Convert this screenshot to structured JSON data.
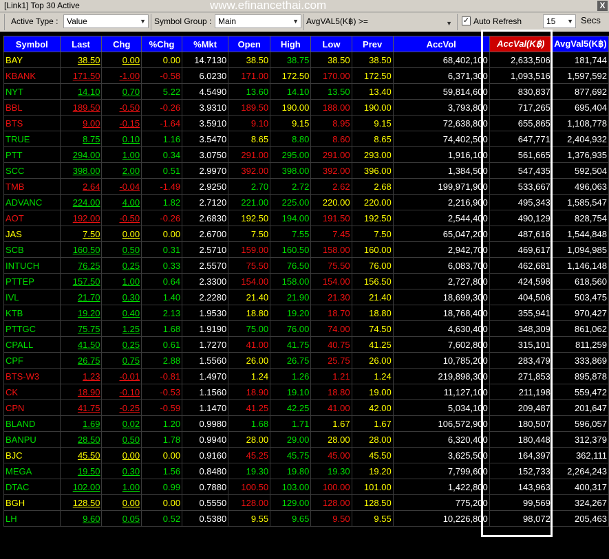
{
  "window": {
    "title": "[Link1] Top 30 Active",
    "watermark": "www.efinancethai.com",
    "close_label": "X"
  },
  "toolbar": {
    "active_type_label": "Active Type :",
    "active_type_value": "Value",
    "symbol_group_label": "Symbol Group :",
    "symbol_group_value": "Main",
    "avgval_label": "AvgVAL5(K฿) >=",
    "auto_refresh_label": "Auto Refresh",
    "auto_refresh_checked": "✓",
    "interval_value": "15",
    "secs_label": "Secs"
  },
  "columns": [
    "Symbol",
    "Last",
    "Chg",
    "%Chg",
    "%Mkt",
    "Open",
    "High",
    "Low",
    "Prev",
    "AccVol",
    "AccVal(K฿)",
    "AvgVal5(K฿)"
  ],
  "sorted_column": "AccVal(K฿)",
  "colors": {
    "up": "#00dd00",
    "down": "#ee1111",
    "unchanged": "#ffff00",
    "header_bg": "#0000ff",
    "sorted_header_bg": "#cc0000"
  },
  "rows": [
    {
      "symbol": "BAY",
      "last": "38.50",
      "chg": "0.00",
      "pct_chg": "0.00",
      "pct_mkt": "14.7130",
      "open": "38.50",
      "high": "38.75",
      "low": "38.50",
      "prev": "38.50",
      "acc_vol": "68,402,100",
      "acc_val": "2,633,506",
      "avg_val5": "181,744",
      "dir": "eq",
      "o": "eq",
      "h": "up",
      "l": "eq"
    },
    {
      "symbol": "KBANK",
      "last": "171.50",
      "chg": "-1.00",
      "pct_chg": "-0.58",
      "pct_mkt": "6.0230",
      "open": "171.00",
      "high": "172.50",
      "low": "170.00",
      "prev": "172.50",
      "acc_vol": "6,371,300",
      "acc_val": "1,093,516",
      "avg_val5": "1,597,592",
      "dir": "dn",
      "o": "dn",
      "h": "eq",
      "l": "dn"
    },
    {
      "symbol": "NYT",
      "last": "14.10",
      "chg": "0.70",
      "pct_chg": "5.22",
      "pct_mkt": "4.5490",
      "open": "13.60",
      "high": "14.10",
      "low": "13.50",
      "prev": "13.40",
      "acc_vol": "59,814,600",
      "acc_val": "830,837",
      "avg_val5": "877,692",
      "dir": "up",
      "o": "up",
      "h": "up",
      "l": "up"
    },
    {
      "symbol": "BBL",
      "last": "189.50",
      "chg": "-0.50",
      "pct_chg": "-0.26",
      "pct_mkt": "3.9310",
      "open": "189.50",
      "high": "190.00",
      "low": "188.00",
      "prev": "190.00",
      "acc_vol": "3,793,800",
      "acc_val": "717,265",
      "avg_val5": "695,404",
      "dir": "dn",
      "o": "dn",
      "h": "eq",
      "l": "dn"
    },
    {
      "symbol": "BTS",
      "last": "9.00",
      "chg": "-0.15",
      "pct_chg": "-1.64",
      "pct_mkt": "3.5910",
      "open": "9.10",
      "high": "9.15",
      "low": "8.95",
      "prev": "9.15",
      "acc_vol": "72,638,800",
      "acc_val": "655,865",
      "avg_val5": "1,108,778",
      "dir": "dn",
      "o": "dn",
      "h": "eq",
      "l": "dn"
    },
    {
      "symbol": "TRUE",
      "last": "8.75",
      "chg": "0.10",
      "pct_chg": "1.16",
      "pct_mkt": "3.5470",
      "open": "8.65",
      "high": "8.80",
      "low": "8.60",
      "prev": "8.65",
      "acc_vol": "74,402,500",
      "acc_val": "647,771",
      "avg_val5": "2,404,932",
      "dir": "up",
      "o": "eq",
      "h": "up",
      "l": "dn"
    },
    {
      "symbol": "PTT",
      "last": "294.00",
      "chg": "1.00",
      "pct_chg": "0.34",
      "pct_mkt": "3.0750",
      "open": "291.00",
      "high": "295.00",
      "low": "291.00",
      "prev": "293.00",
      "acc_vol": "1,916,100",
      "acc_val": "561,665",
      "avg_val5": "1,376,935",
      "dir": "up",
      "o": "dn",
      "h": "up",
      "l": "dn"
    },
    {
      "symbol": "SCC",
      "last": "398.00",
      "chg": "2.00",
      "pct_chg": "0.51",
      "pct_mkt": "2.9970",
      "open": "392.00",
      "high": "398.00",
      "low": "392.00",
      "prev": "396.00",
      "acc_vol": "1,384,500",
      "acc_val": "547,435",
      "avg_val5": "592,504",
      "dir": "up",
      "o": "dn",
      "h": "up",
      "l": "dn"
    },
    {
      "symbol": "TMB",
      "last": "2.64",
      "chg": "-0.04",
      "pct_chg": "-1.49",
      "pct_mkt": "2.9250",
      "open": "2.70",
      "high": "2.72",
      "low": "2.62",
      "prev": "2.68",
      "acc_vol": "199,971,900",
      "acc_val": "533,667",
      "avg_val5": "496,063",
      "dir": "dn",
      "o": "up",
      "h": "up",
      "l": "dn"
    },
    {
      "symbol": "ADVANC",
      "last": "224.00",
      "chg": "4.00",
      "pct_chg": "1.82",
      "pct_mkt": "2.7120",
      "open": "221.00",
      "high": "225.00",
      "low": "220.00",
      "prev": "220.00",
      "acc_vol": "2,216,900",
      "acc_val": "495,343",
      "avg_val5": "1,585,547",
      "dir": "up",
      "o": "up",
      "h": "up",
      "l": "eq"
    },
    {
      "symbol": "AOT",
      "last": "192.00",
      "chg": "-0.50",
      "pct_chg": "-0.26",
      "pct_mkt": "2.6830",
      "open": "192.50",
      "high": "194.00",
      "low": "191.50",
      "prev": "192.50",
      "acc_vol": "2,544,400",
      "acc_val": "490,129",
      "avg_val5": "828,754",
      "dir": "dn",
      "o": "eq",
      "h": "up",
      "l": "dn"
    },
    {
      "symbol": "JAS",
      "last": "7.50",
      "chg": "0.00",
      "pct_chg": "0.00",
      "pct_mkt": "2.6700",
      "open": "7.50",
      "high": "7.55",
      "low": "7.45",
      "prev": "7.50",
      "acc_vol": "65,047,200",
      "acc_val": "487,616",
      "avg_val5": "1,544,848",
      "dir": "eq",
      "o": "eq",
      "h": "up",
      "l": "dn"
    },
    {
      "symbol": "SCB",
      "last": "160.50",
      "chg": "0.50",
      "pct_chg": "0.31",
      "pct_mkt": "2.5710",
      "open": "159.00",
      "high": "160.50",
      "low": "158.00",
      "prev": "160.00",
      "acc_vol": "2,942,700",
      "acc_val": "469,617",
      "avg_val5": "1,094,985",
      "dir": "up",
      "o": "dn",
      "h": "up",
      "l": "dn"
    },
    {
      "symbol": "INTUCH",
      "last": "76.25",
      "chg": "0.25",
      "pct_chg": "0.33",
      "pct_mkt": "2.5570",
      "open": "75.50",
      "high": "76.50",
      "low": "75.50",
      "prev": "76.00",
      "acc_vol": "6,083,700",
      "acc_val": "462,681",
      "avg_val5": "1,146,148",
      "dir": "up",
      "o": "dn",
      "h": "up",
      "l": "dn"
    },
    {
      "symbol": "PTTEP",
      "last": "157.50",
      "chg": "1.00",
      "pct_chg": "0.64",
      "pct_mkt": "2.3300",
      "open": "154.00",
      "high": "158.00",
      "low": "154.00",
      "prev": "156.50",
      "acc_vol": "2,727,800",
      "acc_val": "424,598",
      "avg_val5": "618,560",
      "dir": "up",
      "o": "dn",
      "h": "up",
      "l": "dn"
    },
    {
      "symbol": "IVL",
      "last": "21.70",
      "chg": "0.30",
      "pct_chg": "1.40",
      "pct_mkt": "2.2280",
      "open": "21.40",
      "high": "21.90",
      "low": "21.30",
      "prev": "21.40",
      "acc_vol": "18,699,300",
      "acc_val": "404,506",
      "avg_val5": "503,475",
      "dir": "up",
      "o": "eq",
      "h": "up",
      "l": "dn"
    },
    {
      "symbol": "KTB",
      "last": "19.20",
      "chg": "0.40",
      "pct_chg": "2.13",
      "pct_mkt": "1.9530",
      "open": "18.80",
      "high": "19.20",
      "low": "18.70",
      "prev": "18.80",
      "acc_vol": "18,768,400",
      "acc_val": "355,941",
      "avg_val5": "970,427",
      "dir": "up",
      "o": "eq",
      "h": "up",
      "l": "dn"
    },
    {
      "symbol": "PTTGC",
      "last": "75.75",
      "chg": "1.25",
      "pct_chg": "1.68",
      "pct_mkt": "1.9190",
      "open": "75.00",
      "high": "76.00",
      "low": "74.00",
      "prev": "74.50",
      "acc_vol": "4,630,400",
      "acc_val": "348,309",
      "avg_val5": "861,062",
      "dir": "up",
      "o": "up",
      "h": "up",
      "l": "dn"
    },
    {
      "symbol": "CPALL",
      "last": "41.50",
      "chg": "0.25",
      "pct_chg": "0.61",
      "pct_mkt": "1.7270",
      "open": "41.00",
      "high": "41.75",
      "low": "40.75",
      "prev": "41.25",
      "acc_vol": "7,602,800",
      "acc_val": "315,101",
      "avg_val5": "811,259",
      "dir": "up",
      "o": "dn",
      "h": "up",
      "l": "dn"
    },
    {
      "symbol": "CPF",
      "last": "26.75",
      "chg": "0.75",
      "pct_chg": "2.88",
      "pct_mkt": "1.5560",
      "open": "26.00",
      "high": "26.75",
      "low": "25.75",
      "prev": "26.00",
      "acc_vol": "10,785,200",
      "acc_val": "283,479",
      "avg_val5": "333,869",
      "dir": "up",
      "o": "eq",
      "h": "up",
      "l": "dn"
    },
    {
      "symbol": "BTS-W3",
      "last": "1.23",
      "chg": "-0.01",
      "pct_chg": "-0.81",
      "pct_mkt": "1.4970",
      "open": "1.24",
      "high": "1.26",
      "low": "1.21",
      "prev": "1.24",
      "acc_vol": "219,898,300",
      "acc_val": "271,853",
      "avg_val5": "895,878",
      "dir": "dn",
      "o": "eq",
      "h": "up",
      "l": "dn"
    },
    {
      "symbol": "CK",
      "last": "18.90",
      "chg": "-0.10",
      "pct_chg": "-0.53",
      "pct_mkt": "1.1560",
      "open": "18.90",
      "high": "19.10",
      "low": "18.80",
      "prev": "19.00",
      "acc_vol": "11,127,100",
      "acc_val": "211,198",
      "avg_val5": "559,472",
      "dir": "dn",
      "o": "dn",
      "h": "up",
      "l": "dn"
    },
    {
      "symbol": "CPN",
      "last": "41.75",
      "chg": "-0.25",
      "pct_chg": "-0.59",
      "pct_mkt": "1.1470",
      "open": "41.25",
      "high": "42.25",
      "low": "41.00",
      "prev": "42.00",
      "acc_vol": "5,034,100",
      "acc_val": "209,487",
      "avg_val5": "201,647",
      "dir": "dn",
      "o": "dn",
      "h": "up",
      "l": "dn"
    },
    {
      "symbol": "BLAND",
      "last": "1.69",
      "chg": "0.02",
      "pct_chg": "1.20",
      "pct_mkt": "0.9980",
      "open": "1.68",
      "high": "1.71",
      "low": "1.67",
      "prev": "1.67",
      "acc_vol": "106,572,900",
      "acc_val": "180,507",
      "avg_val5": "596,057",
      "dir": "up",
      "o": "up",
      "h": "up",
      "l": "eq"
    },
    {
      "symbol": "BANPU",
      "last": "28.50",
      "chg": "0.50",
      "pct_chg": "1.78",
      "pct_mkt": "0.9940",
      "open": "28.00",
      "high": "29.00",
      "low": "28.00",
      "prev": "28.00",
      "acc_vol": "6,320,400",
      "acc_val": "180,448",
      "avg_val5": "312,379",
      "dir": "up",
      "o": "eq",
      "h": "up",
      "l": "eq"
    },
    {
      "symbol": "BJC",
      "last": "45.50",
      "chg": "0.00",
      "pct_chg": "0.00",
      "pct_mkt": "0.9160",
      "open": "45.25",
      "high": "45.75",
      "low": "45.00",
      "prev": "45.50",
      "acc_vol": "3,625,500",
      "acc_val": "164,397",
      "avg_val5": "362,111",
      "dir": "eq",
      "o": "dn",
      "h": "up",
      "l": "dn"
    },
    {
      "symbol": "MEGA",
      "last": "19.50",
      "chg": "0.30",
      "pct_chg": "1.56",
      "pct_mkt": "0.8480",
      "open": "19.30",
      "high": "19.80",
      "low": "19.30",
      "prev": "19.20",
      "acc_vol": "7,799,600",
      "acc_val": "152,733",
      "avg_val5": "2,264,243",
      "dir": "up",
      "o": "up",
      "h": "up",
      "l": "up"
    },
    {
      "symbol": "DTAC",
      "last": "102.00",
      "chg": "1.00",
      "pct_chg": "0.99",
      "pct_mkt": "0.7880",
      "open": "100.50",
      "high": "103.00",
      "low": "100.00",
      "prev": "101.00",
      "acc_vol": "1,422,800",
      "acc_val": "143,963",
      "avg_val5": "400,317",
      "dir": "up",
      "o": "dn",
      "h": "up",
      "l": "dn"
    },
    {
      "symbol": "BGH",
      "last": "128.50",
      "chg": "0.00",
      "pct_chg": "0.00",
      "pct_mkt": "0.5550",
      "open": "128.00",
      "high": "129.00",
      "low": "128.00",
      "prev": "128.50",
      "acc_vol": "775,200",
      "acc_val": "99,569",
      "avg_val5": "324,267",
      "dir": "eq",
      "o": "dn",
      "h": "up",
      "l": "dn"
    },
    {
      "symbol": "LH",
      "last": "9.60",
      "chg": "0.05",
      "pct_chg": "0.52",
      "pct_mkt": "0.5380",
      "open": "9.55",
      "high": "9.65",
      "low": "9.50",
      "prev": "9.55",
      "acc_vol": "10,226,800",
      "acc_val": "98,072",
      "avg_val5": "205,463",
      "dir": "up",
      "o": "eq",
      "h": "up",
      "l": "dn"
    }
  ]
}
